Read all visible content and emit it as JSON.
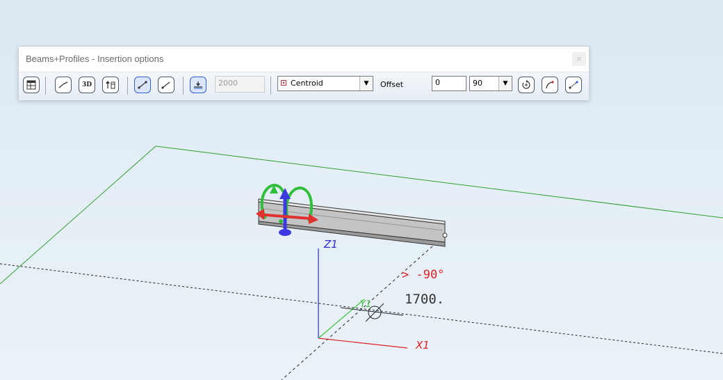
{
  "window": {
    "title": "Beams+Profiles - Insertion options",
    "close_label": "×"
  },
  "toolbar": {
    "buttons": [
      {
        "name": "parameters-button",
        "icon": "table-icon"
      },
      {
        "name": "line-button",
        "icon": "polyline-icon"
      },
      {
        "name": "3d-button",
        "icon": "3d-icon",
        "label": "3D"
      },
      {
        "name": "height-button",
        "icon": "height-arrow-icon"
      },
      {
        "name": "two-point-button",
        "icon": "two-point-line-icon",
        "active": true
      },
      {
        "name": "angle-line-button",
        "icon": "angled-line-icon"
      },
      {
        "name": "reference-level-button",
        "icon": "level-icon",
        "active": true
      }
    ],
    "length_value": "2000",
    "anchor_dropdown": {
      "value": "Centroid"
    },
    "offset_label": "Offset",
    "offset_value": "0",
    "rotation_dropdown": {
      "value": "90"
    },
    "end_buttons": [
      {
        "name": "rotate-button",
        "icon": "rotate-icon"
      },
      {
        "name": "bend-button",
        "icon": "bend-icon"
      },
      {
        "name": "pick-button",
        "icon": "pick-icon"
      }
    ]
  },
  "canvas": {
    "axis_z_label": "Z1",
    "axis_x_label": "X1",
    "axis_y_label": "Y1",
    "angle_readout": "> -90°",
    "length_readout": "1700.",
    "colors": {
      "plane": "#2ca02c",
      "x_axis": "#e02020",
      "z_axis": "#2a2ad8",
      "y_axis": "#3cc03c",
      "angle_text": "#e02020",
      "beam_fill": "#c8c8c8"
    }
  }
}
